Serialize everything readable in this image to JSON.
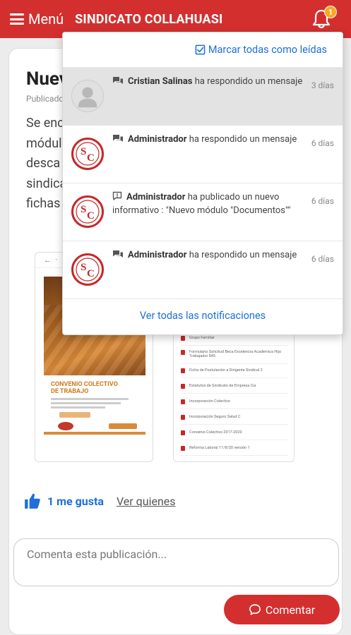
{
  "header": {
    "menu_label": "Menú",
    "app_title": "SINDICATO COLLAHUASI",
    "notification_count": "1"
  },
  "post": {
    "title": "Nuev",
    "meta": "Publicado",
    "body_lines": [
      "Se enc",
      "módul",
      "desca",
      "sindica",
      "fichas"
    ],
    "thumb1": {
      "cover_title_line1": "CONVENIO COLECTIVO",
      "cover_title_line2": "DE TRABAJO"
    },
    "documents": [
      "Grupo Familiar",
      "Formulario Solicitud Beca Excelencia Académica Hijo Trabajador 845",
      "Ficha de Postulación a Dirigente Sindical 2",
      "Estatutos de Sindicato de Empresa Cia",
      "Incorporación Colectivo",
      "Incorporación Seguro Salud C",
      "Convenio Colectivo 2017-2020",
      "Reforma Laboral 11/8/20 versión 1"
    ],
    "like_label": "1 me gusta",
    "who_label": "Ver quienes",
    "comment_placeholder": "Comenta esta publicación...",
    "comment_button": "Comentar"
  },
  "notifications": {
    "mark_all_label": "Marcar todas como leídas",
    "see_all_label": "Ver todas las notificaciones",
    "items": [
      {
        "author": "Cristian Salinas",
        "text": "ha respondido un mensaje",
        "time": "3 días",
        "icon": "chat-icon"
      },
      {
        "author": "Administrador",
        "text": "ha respondido un mensaje",
        "time": "6 días",
        "icon": "chat-icon"
      },
      {
        "author": "Administrador",
        "text": "ha publicado un nuevo informativo : \"Nuevo módulo \"Documentos\"\"",
        "time": "6 días",
        "icon": "announcement-icon"
      },
      {
        "author": "Administrador",
        "text": "ha respondido un mensaje",
        "time": "6 días",
        "icon": "chat-icon"
      }
    ]
  },
  "colors": {
    "brand_red": "#d32f2f",
    "badge": "#f9a825",
    "link_blue": "#1e6fd9"
  }
}
